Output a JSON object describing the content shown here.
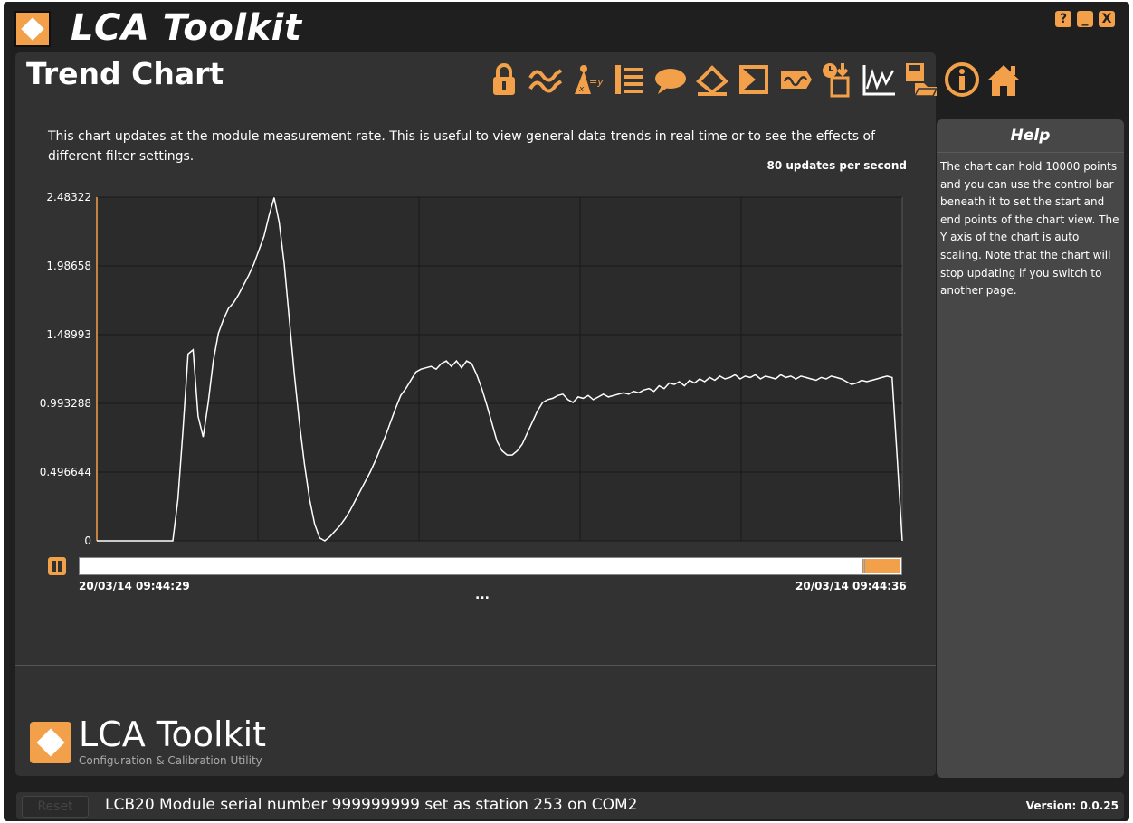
{
  "app": {
    "title": "LCA Toolkit"
  },
  "window_buttons": {
    "help": "?",
    "minimize": "_",
    "close": "X"
  },
  "page": {
    "title": "Trend Chart",
    "description": "This chart updates at the module measurement rate. This is useful to view general data trends in real time or to see the effects of different filter settings.",
    "rate": "80 updates per second"
  },
  "toolbar": {
    "icons": [
      "lock-icon",
      "filter-icon",
      "calibrate-icon",
      "settings-list-icon",
      "comment-icon",
      "zero-icon",
      "sum-icon",
      "signal-icon",
      "logger-icon",
      "trend-chart-icon",
      "save-load-icon",
      "info-icon",
      "home-icon"
    ],
    "accent": "#f3a04b",
    "active": "trend-chart-icon"
  },
  "chart_data": {
    "type": "line",
    "y_tick_labels": [
      "2.48322",
      "1.98658",
      "1.48993",
      "0.993288",
      "0.496644",
      "0"
    ],
    "ylim": [
      0,
      2.48322
    ],
    "series": [
      {
        "values": [
          0,
          0,
          0,
          0,
          0,
          0,
          0,
          0,
          0,
          0,
          0,
          0,
          0,
          0,
          0,
          0,
          0.3,
          0.8,
          1.35,
          1.38,
          0.9,
          0.75,
          1.0,
          1.3,
          1.5,
          1.6,
          1.68,
          1.72,
          1.78,
          1.85,
          1.92,
          2.0,
          2.1,
          2.2,
          2.35,
          2.48,
          2.3,
          2.0,
          1.6,
          1.2,
          0.85,
          0.55,
          0.3,
          0.12,
          0.02,
          0.0,
          0.03,
          0.07,
          0.11,
          0.16,
          0.22,
          0.29,
          0.36,
          0.43,
          0.5,
          0.58,
          0.67,
          0.76,
          0.86,
          0.96,
          1.05,
          1.1,
          1.16,
          1.22,
          1.24,
          1.25,
          1.26,
          1.24,
          1.28,
          1.3,
          1.26,
          1.3,
          1.25,
          1.3,
          1.28,
          1.2,
          1.1,
          0.98,
          0.85,
          0.72,
          0.65,
          0.62,
          0.62,
          0.65,
          0.7,
          0.78,
          0.86,
          0.94,
          1.0,
          1.02,
          1.03,
          1.05,
          1.06,
          1.02,
          1.0,
          1.04,
          1.03,
          1.05,
          1.02,
          1.04,
          1.06,
          1.04,
          1.05,
          1.06,
          1.07,
          1.06,
          1.08,
          1.07,
          1.09,
          1.1,
          1.08,
          1.12,
          1.1,
          1.14,
          1.13,
          1.15,
          1.12,
          1.16,
          1.14,
          1.17,
          1.15,
          1.18,
          1.16,
          1.19,
          1.17,
          1.18,
          1.2,
          1.17,
          1.19,
          1.18,
          1.2,
          1.17,
          1.19,
          1.18,
          1.17,
          1.2,
          1.18,
          1.19,
          1.17,
          1.19,
          1.18,
          1.17,
          1.16,
          1.18,
          1.17,
          1.19,
          1.18,
          1.17,
          1.15,
          1.13,
          1.14,
          1.16,
          1.15,
          1.16,
          1.17,
          1.18,
          1.19,
          1.18,
          0.6,
          0
        ]
      }
    ],
    "grid": true
  },
  "range": {
    "start": "20/03/14 09:44:29",
    "end": "20/03/14 09:44:36",
    "ellipsis": "..."
  },
  "help": {
    "title": "Help",
    "text": "The chart can hold 10000 points and you can use the control bar beneath it to set the start and end points of the chart view. The Y axis of the chart is auto scaling. Note that the chart will stop updating if you switch to another page."
  },
  "brand": {
    "title": "LCA Toolkit",
    "subtitle": "Configuration & Calibration Utility"
  },
  "status": {
    "reset_label": "Reset",
    "message": "LCB20 Module serial number 999999999 set as station 253 on COM2",
    "version": "Version: 0.0.25"
  }
}
